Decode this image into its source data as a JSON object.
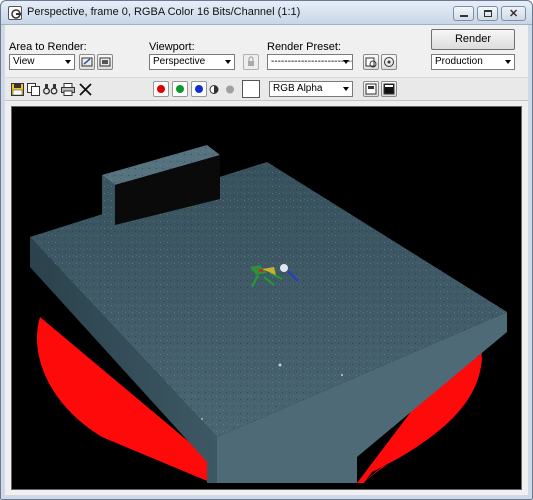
{
  "window": {
    "title": "Perspective, frame 0, RGBA Color 16 Bits/Channel (1:1)"
  },
  "controls": {
    "area_label": "Area to Render:",
    "area_value": "View",
    "viewport_label": "Viewport:",
    "viewport_value": "Perspective",
    "preset_label": "Render Preset:",
    "preset_value": "-------------------------",
    "render_button": "Render",
    "mode_value": "Production"
  },
  "toolbar": {
    "channel_display_value": "RGB Alpha"
  },
  "colors": {
    "red_channel": "#e00000",
    "green_channel": "#0a9a2a",
    "blue_channel": "#1030d0",
    "floor": "#3e5a66",
    "overhang": "#ff0a0a"
  },
  "icons": [
    "save-icon",
    "copy-icon",
    "clone-icon",
    "print-icon",
    "clear-icon",
    "lock-icon",
    "preset-files-icon",
    "environment-icon",
    "mono-channel-icon",
    "color-swatch",
    "toggle-ui-overlay-icon",
    "toggle-ui-icon"
  ]
}
